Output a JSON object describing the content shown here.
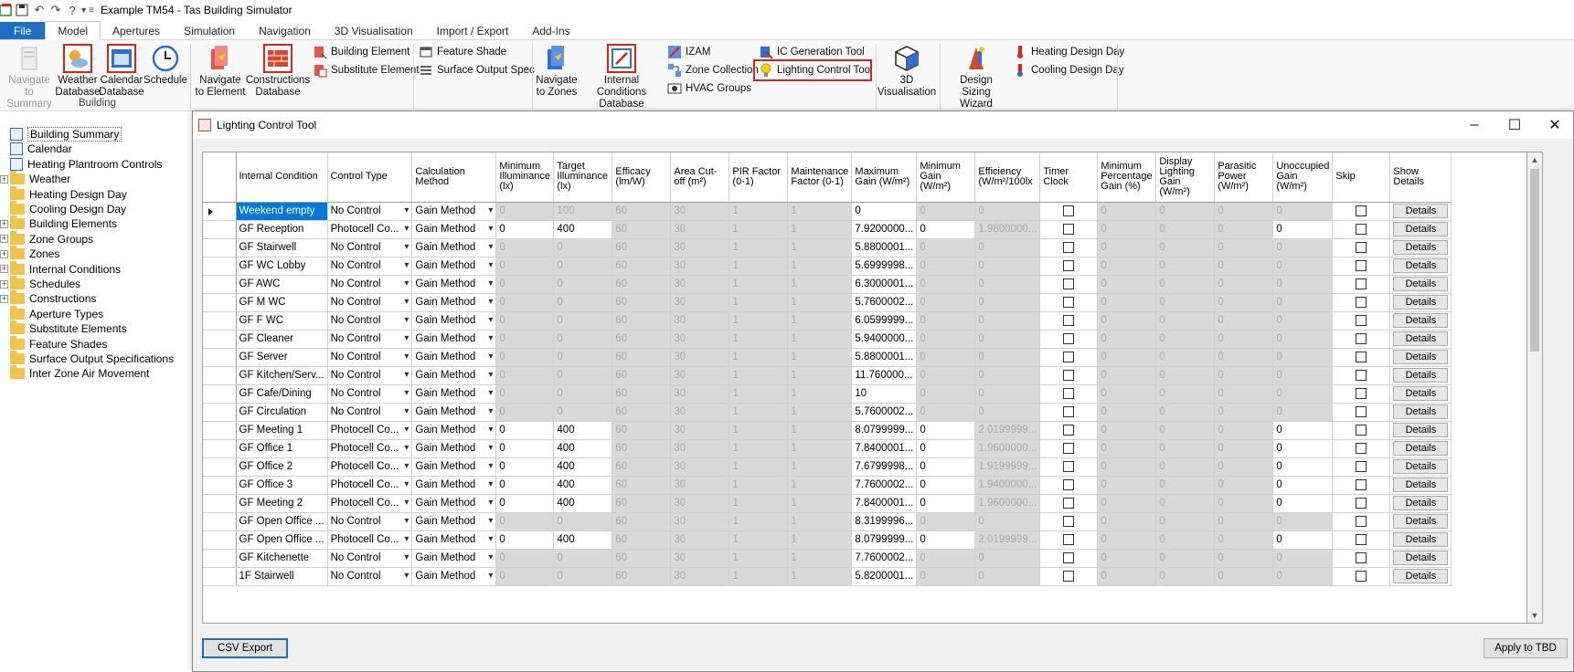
{
  "app": {
    "title": "Example TM54 - Tas Building Simulator"
  },
  "tabs": [
    "File",
    "Model",
    "Apertures",
    "Simulation",
    "Navigation",
    "3D Visualisation",
    "Import / Export",
    "Add-Ins"
  ],
  "ribbon": {
    "navigate_to_summary": "Navigate to Summary",
    "weather_db": "Weather Database",
    "calendar_db": "Calendar Database",
    "schedule": "Schedule",
    "navigate_to_element": "Navigate to Element",
    "constructions_db": "Constructions Database",
    "building_element": "Building Element",
    "substitute_element": "Substitute Element",
    "feature_shade": "Feature Shade",
    "surface_output_spec": "Surface Output Spec",
    "navigate_to_zones": "Navigate to Zones",
    "internal_conditions_db": "Internal Conditions Database",
    "izam": "IZAM",
    "zone_collection": "Zone Collection",
    "hvac_groups": "HVAC Groups",
    "ic_generation_tool": "IC Generation Tool",
    "lighting_control_tool": "Lighting Control Tool",
    "visualisation_3d": "3D Visualisation",
    "design_sizing_wizard": "Design Sizing Wizard",
    "heating_design_day": "Heating Design Day",
    "cooling_design_day": "Cooling Design Day",
    "group_building": "Building"
  },
  "tree": [
    {
      "label": "Building Summary",
      "type": "doc",
      "expander": false
    },
    {
      "label": "Calendar",
      "type": "calendar",
      "expander": false
    },
    {
      "label": "Heating Plantroom Controls",
      "type": "doc2",
      "expander": false
    },
    {
      "label": "Weather",
      "type": "folder",
      "expander": true
    },
    {
      "label": "Heating Design Day",
      "type": "folder",
      "expander": false
    },
    {
      "label": "Cooling Design Day",
      "type": "folder",
      "expander": false
    },
    {
      "label": "Building Elements",
      "type": "folder",
      "expander": true
    },
    {
      "label": "Zone Groups",
      "type": "folder",
      "expander": true
    },
    {
      "label": "Zones",
      "type": "folder",
      "expander": true
    },
    {
      "label": "Internal Conditions",
      "type": "folder",
      "expander": true
    },
    {
      "label": "Schedules",
      "type": "folder",
      "expander": true
    },
    {
      "label": "Constructions",
      "type": "folder",
      "expander": true
    },
    {
      "label": "Aperture Types",
      "type": "folder",
      "expander": false
    },
    {
      "label": "Substitute Elements",
      "type": "folder",
      "expander": false
    },
    {
      "label": "Feature Shades",
      "type": "folder",
      "expander": false
    },
    {
      "label": "Surface Output Specifications",
      "type": "folder",
      "expander": false
    },
    {
      "label": "Inter Zone Air Movement",
      "type": "folder",
      "expander": false
    }
  ],
  "dialog": {
    "title": "Lighting Control Tool",
    "csv_export": "CSV Export",
    "apply": "Apply to TBD",
    "columns": [
      "Internal Condition",
      "Control Type",
      "Calculation Method",
      "Minimum Illuminance (lx)",
      "Target Illuminance (lx)",
      "Efficacy (lm/W)",
      "Area Cut-off (m²)",
      "PIR Factor (0-1)",
      "Maintenance Factor (0-1)",
      "Maximum Gain (W/m²)",
      "Minimum Gain (W/m²)",
      "Efficiency (W/m²/100lx",
      "Timer Clock",
      "Minimum Percentage Gain (%)",
      "Display Lighting Gain (W/m²)",
      "Parasitic Power (W/m²)",
      "Unoccupied Gain (W/m²)",
      "Skip",
      "Show Details"
    ],
    "details_label": "Details",
    "rows": [
      {
        "name": "Weekend empty",
        "ctrl": "No Control",
        "calc": "Gain Method",
        "minlx": "0",
        "tgt": "100",
        "eff": "60",
        "area": "30",
        "pir": "1",
        "mf": "1",
        "maxg": "0",
        "ming": "0",
        "effy": "0",
        "mpg": "0",
        "dlg": "0",
        "pp": "0",
        "ug": "0"
      },
      {
        "name": "GF Reception",
        "ctrl": "Photocell Co...",
        "calc": "Gain Method",
        "minlx": "0",
        "tgt": "400",
        "eff": "60",
        "area": "30",
        "pir": "1",
        "mf": "1",
        "maxg": "7.9200000...",
        "ming": "0",
        "effy": "1.9800000...",
        "mpg": "0",
        "dlg": "0",
        "pp": "0",
        "ug": "0"
      },
      {
        "name": "GF Stairwell",
        "ctrl": "No Control",
        "calc": "Gain Method",
        "minlx": "0",
        "tgt": "0",
        "eff": "60",
        "area": "30",
        "pir": "1",
        "mf": "1",
        "maxg": "5.8800001...",
        "ming": "0",
        "effy": "0",
        "mpg": "0",
        "dlg": "0",
        "pp": "0",
        "ug": "0"
      },
      {
        "name": "GF WC Lobby",
        "ctrl": "No Control",
        "calc": "Gain Method",
        "minlx": "0",
        "tgt": "0",
        "eff": "60",
        "area": "30",
        "pir": "1",
        "mf": "1",
        "maxg": "5.6999998...",
        "ming": "0",
        "effy": "0",
        "mpg": "0",
        "dlg": "0",
        "pp": "0",
        "ug": "0"
      },
      {
        "name": "GF AWC",
        "ctrl": "No Control",
        "calc": "Gain Method",
        "minlx": "0",
        "tgt": "0",
        "eff": "60",
        "area": "30",
        "pir": "1",
        "mf": "1",
        "maxg": "6.3000001...",
        "ming": "0",
        "effy": "0",
        "mpg": "0",
        "dlg": "0",
        "pp": "0",
        "ug": "0"
      },
      {
        "name": "GF M WC",
        "ctrl": "No Control",
        "calc": "Gain Method",
        "minlx": "0",
        "tgt": "0",
        "eff": "60",
        "area": "30",
        "pir": "1",
        "mf": "1",
        "maxg": "5.7600002...",
        "ming": "0",
        "effy": "0",
        "mpg": "0",
        "dlg": "0",
        "pp": "0",
        "ug": "0"
      },
      {
        "name": "GF F WC",
        "ctrl": "No Control",
        "calc": "Gain Method",
        "minlx": "0",
        "tgt": "0",
        "eff": "60",
        "area": "30",
        "pir": "1",
        "mf": "1",
        "maxg": "6.0599999...",
        "ming": "0",
        "effy": "0",
        "mpg": "0",
        "dlg": "0",
        "pp": "0",
        "ug": "0"
      },
      {
        "name": "GF Cleaner",
        "ctrl": "No Control",
        "calc": "Gain Method",
        "minlx": "0",
        "tgt": "0",
        "eff": "60",
        "area": "30",
        "pir": "1",
        "mf": "1",
        "maxg": "5.9400000...",
        "ming": "0",
        "effy": "0",
        "mpg": "0",
        "dlg": "0",
        "pp": "0",
        "ug": "0"
      },
      {
        "name": "GF Server",
        "ctrl": "No Control",
        "calc": "Gain Method",
        "minlx": "0",
        "tgt": "0",
        "eff": "60",
        "area": "30",
        "pir": "1",
        "mf": "1",
        "maxg": "5.8800001...",
        "ming": "0",
        "effy": "0",
        "mpg": "0",
        "dlg": "0",
        "pp": "0",
        "ug": "0"
      },
      {
        "name": "GF Kitchen/Serv...",
        "ctrl": "No Control",
        "calc": "Gain Method",
        "minlx": "0",
        "tgt": "0",
        "eff": "60",
        "area": "30",
        "pir": "1",
        "mf": "1",
        "maxg": "11.760000...",
        "ming": "0",
        "effy": "0",
        "mpg": "0",
        "dlg": "0",
        "pp": "0",
        "ug": "0"
      },
      {
        "name": "GF Cafe/Dining",
        "ctrl": "No Control",
        "calc": "Gain Method",
        "minlx": "0",
        "tgt": "0",
        "eff": "60",
        "area": "30",
        "pir": "1",
        "mf": "1",
        "maxg": "10",
        "ming": "0",
        "effy": "0",
        "mpg": "0",
        "dlg": "0",
        "pp": "0",
        "ug": "0"
      },
      {
        "name": "GF Circulation",
        "ctrl": "No Control",
        "calc": "Gain Method",
        "minlx": "0",
        "tgt": "0",
        "eff": "60",
        "area": "30",
        "pir": "1",
        "mf": "1",
        "maxg": "5.7600002...",
        "ming": "0",
        "effy": "0",
        "mpg": "0",
        "dlg": "0",
        "pp": "0",
        "ug": "0"
      },
      {
        "name": "GF Meeting 1",
        "ctrl": "Photocell Co...",
        "calc": "Gain Method",
        "minlx": "0",
        "tgt": "400",
        "eff": "60",
        "area": "30",
        "pir": "1",
        "mf": "1",
        "maxg": "8.0799999...",
        "ming": "0",
        "effy": "2.0199999...",
        "mpg": "0",
        "dlg": "0",
        "pp": "0",
        "ug": "0"
      },
      {
        "name": "GF Office 1",
        "ctrl": "Photocell Co...",
        "calc": "Gain Method",
        "minlx": "0",
        "tgt": "400",
        "eff": "60",
        "area": "30",
        "pir": "1",
        "mf": "1",
        "maxg": "7.8400001...",
        "ming": "0",
        "effy": "1.9600000...",
        "mpg": "0",
        "dlg": "0",
        "pp": "0",
        "ug": "0"
      },
      {
        "name": "GF Office 2",
        "ctrl": "Photocell Co...",
        "calc": "Gain Method",
        "minlx": "0",
        "tgt": "400",
        "eff": "60",
        "area": "30",
        "pir": "1",
        "mf": "1",
        "maxg": "7.6799998...",
        "ming": "0",
        "effy": "1.9199999...",
        "mpg": "0",
        "dlg": "0",
        "pp": "0",
        "ug": "0"
      },
      {
        "name": "GF Office 3",
        "ctrl": "Photocell Co...",
        "calc": "Gain Method",
        "minlx": "0",
        "tgt": "400",
        "eff": "60",
        "area": "30",
        "pir": "1",
        "mf": "1",
        "maxg": "7.7600002...",
        "ming": "0",
        "effy": "1.9400000...",
        "mpg": "0",
        "dlg": "0",
        "pp": "0",
        "ug": "0"
      },
      {
        "name": "GF Meeting 2",
        "ctrl": "Photocell Co...",
        "calc": "Gain Method",
        "minlx": "0",
        "tgt": "400",
        "eff": "60",
        "area": "30",
        "pir": "1",
        "mf": "1",
        "maxg": "7.8400001...",
        "ming": "0",
        "effy": "1.9600000...",
        "mpg": "0",
        "dlg": "0",
        "pp": "0",
        "ug": "0"
      },
      {
        "name": "GF Open Office ...",
        "ctrl": "No Control",
        "calc": "Gain Method",
        "minlx": "0",
        "tgt": "0",
        "eff": "60",
        "area": "30",
        "pir": "1",
        "mf": "1",
        "maxg": "8.3199996...",
        "ming": "0",
        "effy": "0",
        "mpg": "0",
        "dlg": "0",
        "pp": "0",
        "ug": "0"
      },
      {
        "name": "GF Open Office ...",
        "ctrl": "Photocell Co...",
        "calc": "Gain Method",
        "minlx": "0",
        "tgt": "400",
        "eff": "60",
        "area": "30",
        "pir": "1",
        "mf": "1",
        "maxg": "8.0799999...",
        "ming": "0",
        "effy": "2.0199999...",
        "mpg": "0",
        "dlg": "0",
        "pp": "0",
        "ug": "0"
      },
      {
        "name": "GF Kitchenette",
        "ctrl": "No Control",
        "calc": "Gain Method",
        "minlx": "0",
        "tgt": "0",
        "eff": "60",
        "area": "30",
        "pir": "1",
        "mf": "1",
        "maxg": "7.7600002...",
        "ming": "0",
        "effy": "0",
        "mpg": "0",
        "dlg": "0",
        "pp": "0",
        "ug": "0"
      },
      {
        "name": "1F Stairwell",
        "ctrl": "No Control",
        "calc": "Gain Method",
        "minlx": "0",
        "tgt": "0",
        "eff": "60",
        "area": "30",
        "pir": "1",
        "mf": "1",
        "maxg": "5.8200001...",
        "ming": "0",
        "effy": "0",
        "mpg": "0",
        "dlg": "0",
        "pp": "0",
        "ug": "0"
      }
    ]
  },
  "colors": {
    "accent": "#1e6fc3",
    "highlight": "#e0201b",
    "readonly_cell": "#d9d9d9",
    "selection": "#0078d7"
  }
}
